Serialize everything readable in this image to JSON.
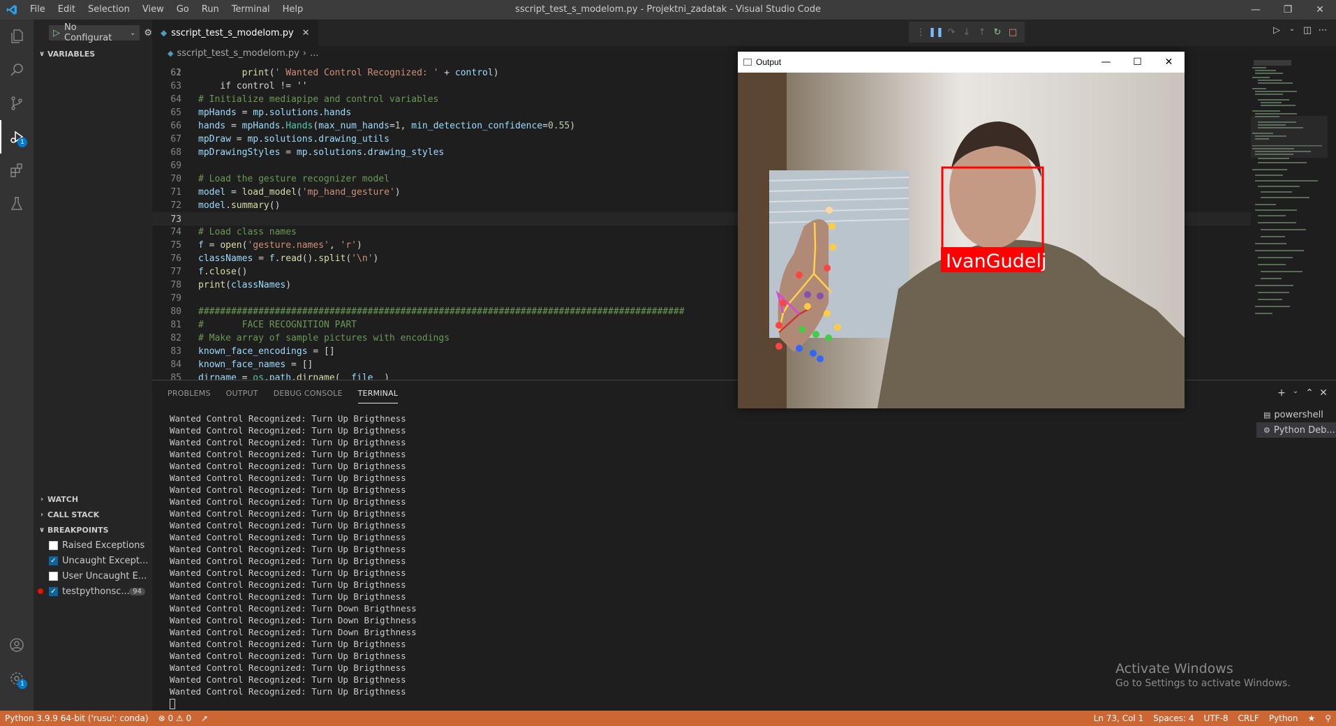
{
  "window": {
    "title": "sscript_test_s_modelom.py - Projektni_zadatak - Visual Studio Code",
    "menu": [
      "File",
      "Edit",
      "Selection",
      "View",
      "Go",
      "Run",
      "Terminal",
      "Help"
    ]
  },
  "sidebar": {
    "config": "No Configurat",
    "variables": "VARIABLES",
    "watch": "WATCH",
    "call_stack": "CALL STACK",
    "breakpoints_header": "BREAKPOINTS",
    "breakpoints": [
      {
        "label": "Raised Exceptions",
        "checked": false
      },
      {
        "label": "Uncaught Except...",
        "checked": true
      },
      {
        "label": "User Uncaught E...",
        "checked": false
      },
      {
        "label": "testpythonsc...",
        "checked": true,
        "count": "94"
      }
    ]
  },
  "tab": {
    "label": "sscript_test_s_modelom.py"
  },
  "breadcrumb": {
    "file": "sscript_test_s_modelom.py",
    "rest": "..."
  },
  "code": {
    "partial_top": "    if control != ''",
    "lines": [
      {
        "n": "62",
        "parts": [
          [
            "",
            "        "
          ],
          [
            "fn",
            "print"
          ],
          [
            "",
            "("
          ],
          [
            "str",
            "' Wanted Control Recognized: '"
          ],
          [
            "",
            " + "
          ],
          [
            "var",
            "control"
          ],
          [
            "",
            ")"
          ]
        ]
      },
      {
        "n": "63",
        "parts": []
      },
      {
        "n": "64",
        "parts": [
          [
            "com",
            "# Initialize mediapipe and control variables"
          ]
        ]
      },
      {
        "n": "65",
        "parts": [
          [
            "var",
            "mpHands"
          ],
          [
            "",
            " = "
          ],
          [
            "var",
            "mp"
          ],
          [
            "",
            "."
          ],
          [
            "var",
            "solutions"
          ],
          [
            "",
            "."
          ],
          [
            "var",
            "hands"
          ]
        ]
      },
      {
        "n": "66",
        "parts": [
          [
            "var",
            "hands"
          ],
          [
            "",
            " = "
          ],
          [
            "var",
            "mpHands"
          ],
          [
            "",
            "."
          ],
          [
            "mod",
            "Hands"
          ],
          [
            "",
            "("
          ],
          [
            "var",
            "max_num_hands"
          ],
          [
            "",
            "="
          ],
          [
            "num",
            "1"
          ],
          [
            "",
            ", "
          ],
          [
            "var",
            "min_detection_confidence"
          ],
          [
            "",
            "="
          ],
          [
            "num",
            "0.55"
          ],
          [
            "",
            ")"
          ]
        ]
      },
      {
        "n": "67",
        "parts": [
          [
            "var",
            "mpDraw"
          ],
          [
            "",
            " = "
          ],
          [
            "var",
            "mp"
          ],
          [
            "",
            "."
          ],
          [
            "var",
            "solutions"
          ],
          [
            "",
            "."
          ],
          [
            "var",
            "drawing_utils"
          ]
        ]
      },
      {
        "n": "68",
        "parts": [
          [
            "var",
            "mpDrawingStyles"
          ],
          [
            "",
            " = "
          ],
          [
            "var",
            "mp"
          ],
          [
            "",
            "."
          ],
          [
            "var",
            "solutions"
          ],
          [
            "",
            "."
          ],
          [
            "var",
            "drawing_styles"
          ]
        ]
      },
      {
        "n": "69",
        "parts": []
      },
      {
        "n": "70",
        "parts": [
          [
            "com",
            "# Load the gesture recognizer model"
          ]
        ]
      },
      {
        "n": "71",
        "parts": [
          [
            "var",
            "model"
          ],
          [
            "",
            " = "
          ],
          [
            "fn",
            "load_model"
          ],
          [
            "",
            "("
          ],
          [
            "str",
            "'mp_hand_gesture'"
          ],
          [
            "",
            ")"
          ]
        ]
      },
      {
        "n": "72",
        "parts": [
          [
            "var",
            "model"
          ],
          [
            "",
            "."
          ],
          [
            "fn",
            "summary"
          ],
          [
            "",
            "()"
          ]
        ]
      },
      {
        "n": "73",
        "parts": [],
        "current": true
      },
      {
        "n": "74",
        "parts": [
          [
            "com",
            "# Load class names"
          ]
        ]
      },
      {
        "n": "75",
        "parts": [
          [
            "var",
            "f"
          ],
          [
            "",
            " = "
          ],
          [
            "fn",
            "open"
          ],
          [
            "",
            "("
          ],
          [
            "str",
            "'gesture.names'"
          ],
          [
            "",
            ", "
          ],
          [
            "str",
            "'r'"
          ],
          [
            "",
            ")"
          ]
        ]
      },
      {
        "n": "76",
        "parts": [
          [
            "var",
            "classNames"
          ],
          [
            "",
            " = "
          ],
          [
            "var",
            "f"
          ],
          [
            "",
            "."
          ],
          [
            "fn",
            "read"
          ],
          [
            "",
            "()."
          ],
          [
            "fn",
            "split"
          ],
          [
            "",
            "("
          ],
          [
            "str",
            "'\\n'"
          ],
          [
            "",
            ")"
          ]
        ]
      },
      {
        "n": "77",
        "parts": [
          [
            "var",
            "f"
          ],
          [
            "",
            "."
          ],
          [
            "fn",
            "close"
          ],
          [
            "",
            "()"
          ]
        ]
      },
      {
        "n": "78",
        "parts": [
          [
            "fn",
            "print"
          ],
          [
            "",
            "("
          ],
          [
            "var",
            "classNames"
          ],
          [
            "",
            ")"
          ]
        ]
      },
      {
        "n": "79",
        "parts": []
      },
      {
        "n": "80",
        "parts": [
          [
            "com",
            "#########################################################################################"
          ]
        ]
      },
      {
        "n": "81",
        "parts": [
          [
            "com",
            "#       FACE RECOGNITION PART"
          ]
        ]
      },
      {
        "n": "82",
        "parts": [
          [
            "com",
            "# Make array of sample pictures with encodings"
          ]
        ]
      },
      {
        "n": "83",
        "parts": [
          [
            "var",
            "known_face_encodings"
          ],
          [
            "",
            " = []"
          ]
        ]
      },
      {
        "n": "84",
        "parts": [
          [
            "var",
            "known_face_names"
          ],
          [
            "",
            " = []"
          ]
        ]
      },
      {
        "n": "85",
        "parts": [
          [
            "var",
            "dirname"
          ],
          [
            "",
            " = "
          ],
          [
            "mod",
            "os"
          ],
          [
            "",
            "."
          ],
          [
            "var",
            "path"
          ],
          [
            "",
            "."
          ],
          [
            "fn",
            "dirname"
          ],
          [
            "",
            "("
          ],
          [
            "var",
            "__file__"
          ],
          [
            "",
            ")"
          ]
        ]
      }
    ]
  },
  "panel": {
    "tabs": [
      "PROBLEMS",
      "OUTPUT",
      "DEBUG CONSOLE",
      "TERMINAL"
    ],
    "active_tab": "TERMINAL",
    "terminal_lines": [
      "Wanted Control Recognized: Turn Up Brigthness",
      "Wanted Control Recognized: Turn Up Brigthness",
      "Wanted Control Recognized: Turn Up Brigthness",
      "Wanted Control Recognized: Turn Up Brigthness",
      "Wanted Control Recognized: Turn Up Brigthness",
      "Wanted Control Recognized: Turn Up Brigthness",
      "Wanted Control Recognized: Turn Up Brigthness",
      "Wanted Control Recognized: Turn Up Brigthness",
      "Wanted Control Recognized: Turn Up Brigthness",
      "Wanted Control Recognized: Turn Up Brigthness",
      "Wanted Control Recognized: Turn Up Brigthness",
      "Wanted Control Recognized: Turn Up Brigthness",
      "Wanted Control Recognized: Turn Up Brigthness",
      "Wanted Control Recognized: Turn Up Brigthness",
      "Wanted Control Recognized: Turn Up Brigthness",
      "Wanted Control Recognized: Turn Up Brigthness",
      "Wanted Control Recognized: Turn Down Brigthness",
      "Wanted Control Recognized: Turn Down Brigthness",
      "Wanted Control Recognized: Turn Down Brigthness",
      "Wanted Control Recognized: Turn Up Brigthness",
      "Wanted Control Recognized: Turn Up Brigthness",
      "Wanted Control Recognized: Turn Up Brigthness",
      "Wanted Control Recognized: Turn Up Brigthness",
      "Wanted Control Recognized: Turn Up Brigthness"
    ],
    "terminals": [
      {
        "label": "powershell"
      },
      {
        "label": "Python Deb..."
      }
    ]
  },
  "activation": {
    "line1": "Activate Windows",
    "line2": "Go to Settings to activate Windows."
  },
  "statusbar": {
    "python": "Python 3.9.9 64-bit ('rusu': conda)",
    "errors": "0",
    "warnings": "0",
    "position": "Ln 73, Col 1",
    "spaces": "Spaces: 4",
    "encoding": "UTF-8",
    "eol": "CRLF",
    "language": "Python"
  },
  "output_window": {
    "title": "Output",
    "face_label": "IvanGudelj"
  },
  "colors": {
    "statusbar": "#cc6633",
    "accent": "#007acc",
    "face_box": "#ff0000"
  }
}
